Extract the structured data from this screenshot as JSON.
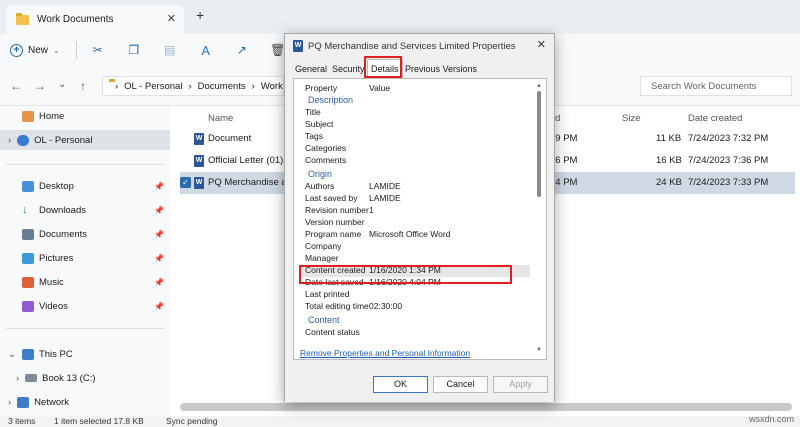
{
  "window": {
    "tab_title": "Work Documents",
    "tab_close": "✕",
    "new_tab": "+"
  },
  "toolbar": {
    "new_label": "New",
    "new_chevron": "⌄"
  },
  "navigation": {
    "back": "←",
    "forward": "→",
    "down": "⌄",
    "up": "↑"
  },
  "address": {
    "chevron": "›",
    "path": [
      "OL - Personal",
      "Documents",
      "Work D"
    ]
  },
  "search": {
    "placeholder": "Search Work Documents"
  },
  "sidebar": {
    "home": "Home",
    "ol_personal": "OL - Personal",
    "desktop": "Desktop",
    "downloads": "Downloads",
    "documents": "Documents",
    "pictures": "Pictures",
    "music": "Music",
    "videos": "Videos",
    "this_pc": "This PC",
    "drive": "Book 13 (C:)",
    "network": "Network"
  },
  "columns": {
    "name": "Name",
    "date_modified": "d",
    "type": "",
    "size": "Size",
    "date_created": "Date created"
  },
  "files": [
    {
      "name": "Document",
      "time": "39 PM",
      "size": "11 KB",
      "created": "7/24/2023 7:32 PM"
    },
    {
      "name": "Official Letter (01)",
      "time": "16 PM",
      "size": "16 KB",
      "created": "7/24/2023 7:36 PM"
    },
    {
      "name": "PQ Merchandise an",
      "time": "04 PM",
      "size": "24 KB",
      "created": "7/24/2023 7:33 PM"
    }
  ],
  "status": {
    "items": "3 items",
    "selected": "1 item selected  17.8 KB",
    "sync": "Sync pending"
  },
  "watermark": "wsxdn.com",
  "dialog": {
    "title": "PQ Merchandise and Services Limited Properties",
    "close": "✕",
    "tabs": [
      "General",
      "Security",
      "Details",
      "Previous Versions"
    ],
    "header": {
      "property": "Property",
      "value": "Value"
    },
    "sections": {
      "description": "Description",
      "origin": "Origin",
      "content": "Content"
    },
    "description_rows": [
      "Title",
      "Subject",
      "Tags",
      "Categories",
      "Comments"
    ],
    "origin_rows": [
      {
        "k": "Authors",
        "v": "LAMIDE"
      },
      {
        "k": "Last saved by",
        "v": "LAMIDE"
      },
      {
        "k": "Revision number",
        "v": "1"
      },
      {
        "k": "Version number",
        "v": ""
      },
      {
        "k": "Program name",
        "v": "Microsoft Office Word"
      },
      {
        "k": "Company",
        "v": ""
      },
      {
        "k": "Manager",
        "v": ""
      },
      {
        "k": "Content created",
        "v": "1/16/2020 1:34 PM"
      },
      {
        "k": "Date last saved",
        "v": "1/16/2020 4:04 PM"
      },
      {
        "k": "Last printed",
        "v": ""
      },
      {
        "k": "Total editing time",
        "v": "02:30:00"
      }
    ],
    "content_rows": [
      "Content status"
    ],
    "link": "Remove Properties and Personal Information",
    "buttons": {
      "ok": "OK",
      "cancel": "Cancel",
      "apply": "Apply"
    }
  }
}
